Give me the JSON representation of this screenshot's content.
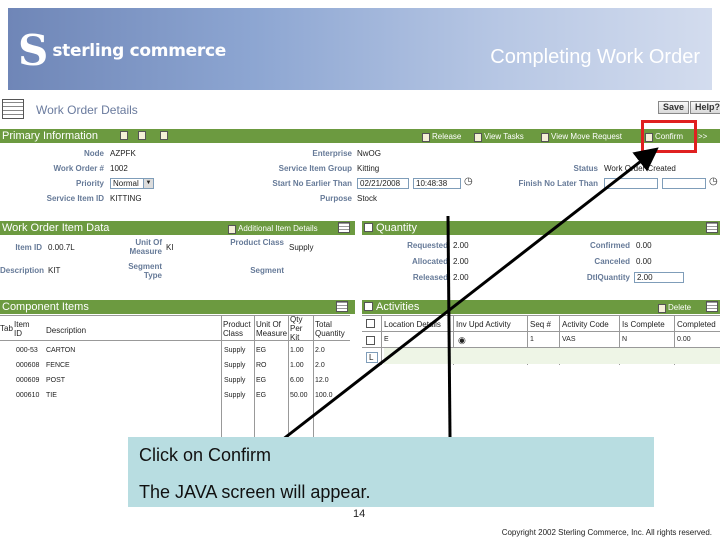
{
  "banner": {
    "logo_mark": "S",
    "logo_text": "sterling commerce",
    "title": "Completing Work Order"
  },
  "page": {
    "title": "Work Order Details",
    "save_label": "Save",
    "help_label": "Help?"
  },
  "primary": {
    "header": "Primary Information",
    "actions": [
      "Release",
      "View Tasks",
      "View Move Request",
      "Confirm"
    ],
    "more": ">>",
    "fields": {
      "node_label": "Node",
      "node_value": "AZPFK",
      "work_order_label": "Work Order #",
      "work_order_value": "1002",
      "priority_label": "Priority",
      "priority_value": "Normal",
      "service_item_label": "Service Item ID",
      "service_item_value": "KITTING",
      "enterprise_label": "Enterprise",
      "enterprise_value": "NwOG",
      "service_group_label": "Service Item Group",
      "service_group_value": "Kitting",
      "start_label": "Start No Earlier Than",
      "start_date": "02/21/2008",
      "start_time": "10:48:38",
      "purpose_label": "Purpose",
      "purpose_value": "Stock",
      "status_label": "Status",
      "status_value": "Work Order Created",
      "finish_label": "Finish No Later Than"
    }
  },
  "item_data": {
    "header": "Work Order Item Data",
    "link": "Additional Item Details",
    "item_id_label": "Item ID",
    "item_id_value": "0.00.7L",
    "uom_label": "Unit Of Measure",
    "uom_value": "KI",
    "product_class_label": "Product Class",
    "product_class_value": "Supply",
    "description_label": "Description",
    "description_value": "KIT",
    "segment_type_label": "Segment Type",
    "segment_label": "Segment"
  },
  "quantity": {
    "header": "Quantity",
    "requested_label": "Requested",
    "requested_value": "2.00",
    "allocated_label": "Allocated",
    "allocated_value": "2.00",
    "released_label": "Released",
    "released_value": "2.00",
    "confirmed_label": "Confirmed",
    "confirmed_value": "0.00",
    "canceled_label": "Canceled",
    "canceled_value": "0.00",
    "dtl_label": "DtlQuantity",
    "dtl_value": "2.00"
  },
  "components": {
    "header": "Component Items",
    "columns": [
      "Tab",
      "Item ID",
      "Description",
      "Product Class",
      "Unit Of Measure",
      "Qty Per Kit",
      "Total Quantity"
    ],
    "rows": [
      {
        "id": "000-53",
        "desc": "CARTON",
        "cls": "Supply",
        "uom": "EG",
        "per": "1.00",
        "total": "2.0"
      },
      {
        "id": "000608",
        "desc": "FENCE",
        "cls": "Supply",
        "uom": "RO",
        "per": "1.00",
        "total": "2.0"
      },
      {
        "id": "000609",
        "desc": "POST",
        "cls": "Supply",
        "uom": "EG",
        "per": "6.00",
        "total": "12.0"
      },
      {
        "id": "000610",
        "desc": "TIE",
        "cls": "Supply",
        "uom": "EG",
        "per": "50.00",
        "total": "100.0"
      }
    ]
  },
  "activities": {
    "header": "Activities",
    "delete_label": "Delete",
    "columns": [
      "Location Details",
      "Inv Upd Activity",
      "Seq #",
      "Activity Code",
      "Is Complete",
      "Completed"
    ],
    "row": {
      "loc": "E",
      "seq": "1",
      "code": "VAS",
      "complete": "N",
      "completed": "0.00"
    },
    "add_cell": "L"
  },
  "callout": {
    "line1": "Click on Confirm",
    "line2": "The JAVA screen will appear."
  },
  "footer": {
    "page_number": "14",
    "copyright": "Copyright 2002 Sterling Commerce, Inc. All rights reserved."
  }
}
